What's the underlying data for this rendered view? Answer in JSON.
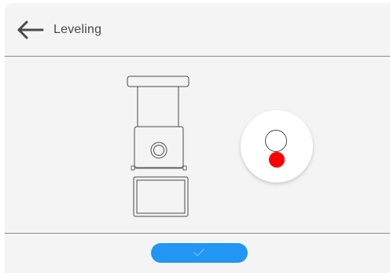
{
  "header": {
    "title": "Leveling",
    "back_icon": "arrow-left-icon"
  },
  "level_indicator": {
    "status": "not-level",
    "bubble_color": "#ff0000",
    "ring_color": "#4a4a4a"
  },
  "footer": {
    "confirm_icon": "checkmark-icon",
    "button_color": "#2196f3"
  }
}
